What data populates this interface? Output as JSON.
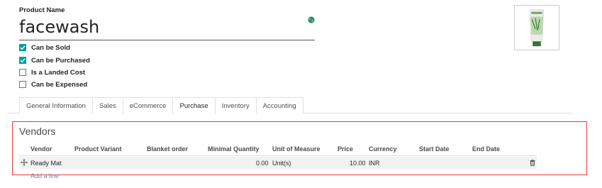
{
  "product": {
    "name_label": "Product Name",
    "name_value": "facewash"
  },
  "checkboxes": [
    {
      "label": "Can be Sold",
      "checked": true
    },
    {
      "label": "Can be Purchased",
      "checked": true
    },
    {
      "label": "Is a Landed Cost",
      "checked": false
    },
    {
      "label": "Can be Expensed",
      "checked": false
    }
  ],
  "tabs": [
    {
      "label": "General Information",
      "active": false
    },
    {
      "label": "Sales",
      "active": false
    },
    {
      "label": "eCommerce",
      "active": false
    },
    {
      "label": "Purchase",
      "active": true
    },
    {
      "label": "Inventory",
      "active": false
    },
    {
      "label": "Accounting",
      "active": false
    }
  ],
  "vendors": {
    "title": "Vendors",
    "columns": {
      "vendor": "Vendor",
      "product_variant": "Product Variant",
      "blanket_order": "Blanket order",
      "min_qty": "Minimal Quantity",
      "uom": "Unit of Measure",
      "price": "Price",
      "currency": "Currency",
      "start_date": "Start Date",
      "end_date": "End Date"
    },
    "rows": [
      {
        "vendor": "Ready Mat",
        "product_variant": "",
        "blanket_order": "",
        "min_qty": "0.00",
        "uom": "Unit(s)",
        "price": "10.00",
        "currency": "INR",
        "start_date": "",
        "end_date": ""
      }
    ],
    "add_line": "Add a line"
  },
  "colors": {
    "accent_checkbox": "#00a09d",
    "highlight_border": "#e63a3a",
    "link": "#7c7bad"
  }
}
